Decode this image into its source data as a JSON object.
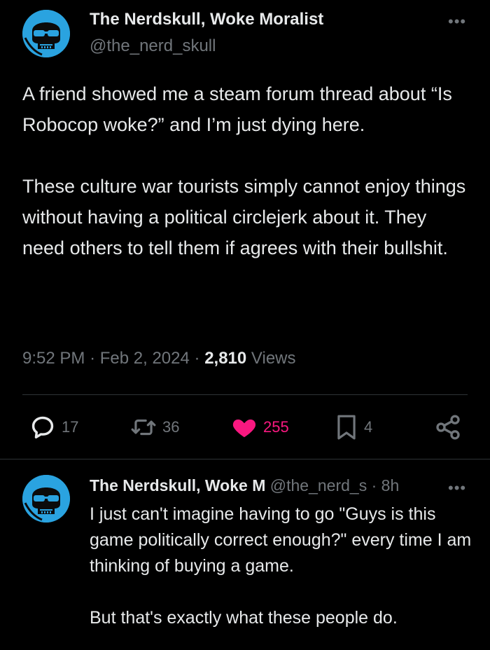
{
  "colors": {
    "background": "#000000",
    "text": "#e7e9ea",
    "muted": "#71767b",
    "like_accent": "#f91880",
    "avatar_blue": "#2aa3e0"
  },
  "tweet": {
    "display_name": "The Nerdskull, Woke Moralist",
    "handle": "@the_nerd_skull",
    "avatar_icon": "skull-sunglasses-avatar",
    "text_paragraphs": [
      "A friend showed me a steam forum thread about “Is Robocop woke?” and I’m just dying here.",
      "These culture war tourists simply cannot enjoy things without having a political circlejerk about it. They need others to tell them if agrees with their bullshit."
    ],
    "time": "9:52 PM",
    "date": "Feb 2, 2024",
    "separator": "·",
    "views_count": "2,810",
    "views_label": "Views",
    "actions": {
      "replies": "17",
      "reposts": "36",
      "likes": "255",
      "bookmarks": "4",
      "liked": true
    }
  },
  "reply": {
    "display_name_truncated": "The Nerdskull, Woke M",
    "handle_truncated": "@the_nerd_s",
    "separator": "·",
    "age": "8h",
    "avatar_icon": "skull-sunglasses-avatar",
    "text_paragraphs": [
      "I just can't imagine having to go \"Guys is this game politically correct enough?\" every time I am thinking of buying a game.",
      "But that's exactly what these people do."
    ]
  }
}
